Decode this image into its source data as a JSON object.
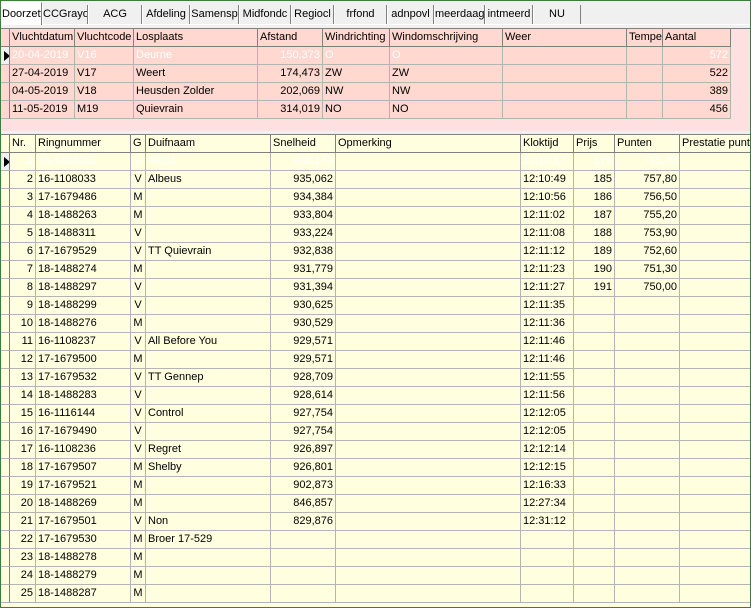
{
  "tabs": [
    "Doorzett",
    "CCGrayor",
    "ACG",
    "Afdeling",
    "Samensp",
    "Midfondc",
    "Regiocl",
    "frfond",
    "adnpovl",
    "meerdaag",
    "intmeerd",
    "NU"
  ],
  "flights": {
    "columns": [
      "Vluchtdatum",
      "Vluchtcode",
      "Losplaats",
      "Afstand",
      "Windrichting",
      "Windomschrijving",
      "Weer",
      "Tempe",
      "Aantal"
    ],
    "rows": [
      [
        "20-04-2019",
        "V16",
        "Deurne",
        "150,373",
        "O",
        "O",
        "",
        "",
        "572"
      ],
      [
        "27-04-2019",
        "V17",
        "Weert",
        "174,473",
        "ZW",
        "ZW",
        "",
        "",
        "522"
      ],
      [
        "04-05-2019",
        "V18",
        "Heusden Zolder",
        "202,069",
        "NW",
        "NW",
        "",
        "",
        "389"
      ],
      [
        "11-05-2019",
        "M19",
        "Quievrain",
        "314,019",
        "NO",
        "NO",
        "",
        "",
        "456"
      ]
    ]
  },
  "results": {
    "columns": [
      "Nr.",
      "Ringnummer",
      "G",
      "Duifnaam",
      "Snelheid",
      "Opmerking",
      "Kloktijd",
      "Prijs",
      "Punten",
      "Prestatie punten"
    ],
    "rows": [
      [
        "1",
        "18-1488268",
        "V",
        "RES1",
        "938,173",
        "",
        "12:10:17",
        "179",
        "765,70",
        ""
      ],
      [
        "2",
        "16-1108033",
        "V",
        "Albeus",
        "935,062",
        "",
        "12:10:49",
        "185",
        "757,80",
        ""
      ],
      [
        "3",
        "17-1679486",
        "M",
        "",
        "934,384",
        "",
        "12:10:56",
        "186",
        "756,50",
        ""
      ],
      [
        "4",
        "18-1488263",
        "M",
        "",
        "933,804",
        "",
        "12:11:02",
        "187",
        "755,20",
        ""
      ],
      [
        "5",
        "18-1488311",
        "V",
        "",
        "933,224",
        "",
        "12:11:08",
        "188",
        "753,90",
        ""
      ],
      [
        "6",
        "17-1679529",
        "V",
        "TT Quievrain",
        "932,838",
        "",
        "12:11:12",
        "189",
        "752,60",
        ""
      ],
      [
        "7",
        "18-1488274",
        "M",
        "",
        "931,779",
        "",
        "12:11:23",
        "190",
        "751,30",
        ""
      ],
      [
        "8",
        "18-1488297",
        "V",
        "",
        "931,394",
        "",
        "12:11:27",
        "191",
        "750,00",
        ""
      ],
      [
        "9",
        "18-1488299",
        "V",
        "",
        "930,625",
        "",
        "12:11:35",
        "",
        "",
        ""
      ],
      [
        "10",
        "18-1488276",
        "M",
        "",
        "930,529",
        "",
        "12:11:36",
        "",
        "",
        ""
      ],
      [
        "11",
        "16-1108237",
        "V",
        "All Before You",
        "929,571",
        "",
        "12:11:46",
        "",
        "",
        ""
      ],
      [
        "12",
        "17-1679500",
        "M",
        "",
        "929,571",
        "",
        "12:11:46",
        "",
        "",
        ""
      ],
      [
        "13",
        "17-1679532",
        "V",
        "TT Gennep",
        "928,709",
        "",
        "12:11:55",
        "",
        "",
        ""
      ],
      [
        "14",
        "18-1488283",
        "V",
        "",
        "928,614",
        "",
        "12:11:56",
        "",
        "",
        ""
      ],
      [
        "15",
        "16-1116144",
        "V",
        "Control",
        "927,754",
        "",
        "12:12:05",
        "",
        "",
        ""
      ],
      [
        "16",
        "17-1679490",
        "V",
        "",
        "927,754",
        "",
        "12:12:05",
        "",
        "",
        ""
      ],
      [
        "17",
        "16-1108236",
        "V",
        "Regret",
        "926,897",
        "",
        "12:12:14",
        "",
        "",
        ""
      ],
      [
        "18",
        "17-1679507",
        "M",
        "Shelby",
        "926,801",
        "",
        "12:12:15",
        "",
        "",
        ""
      ],
      [
        "19",
        "17-1679521",
        "M",
        "",
        "902,873",
        "",
        "12:16:33",
        "",
        "",
        ""
      ],
      [
        "20",
        "18-1488269",
        "M",
        "",
        "846,857",
        "",
        "12:27:34",
        "",
        "",
        ""
      ],
      [
        "21",
        "17-1679501",
        "V",
        "Non",
        "829,876",
        "",
        "12:31:12",
        "",
        "",
        ""
      ],
      [
        "22",
        "17-1679530",
        "M",
        "Broer 17-529",
        "",
        "",
        "",
        "",
        "",
        ""
      ],
      [
        "23",
        "18-1488278",
        "M",
        "",
        "",
        "",
        "",
        "",
        "",
        ""
      ],
      [
        "24",
        "18-1488279",
        "M",
        "",
        "",
        "",
        "",
        "",
        "",
        ""
      ],
      [
        "25",
        "18-1488287",
        "M",
        "",
        "",
        "",
        "",
        "",
        "",
        ""
      ]
    ]
  },
  "colors": {
    "selection": "#0078d7",
    "flights_bg": "#ffd8d0",
    "results_bg": "#ffffe0",
    "frame": "#3c7d3c"
  }
}
